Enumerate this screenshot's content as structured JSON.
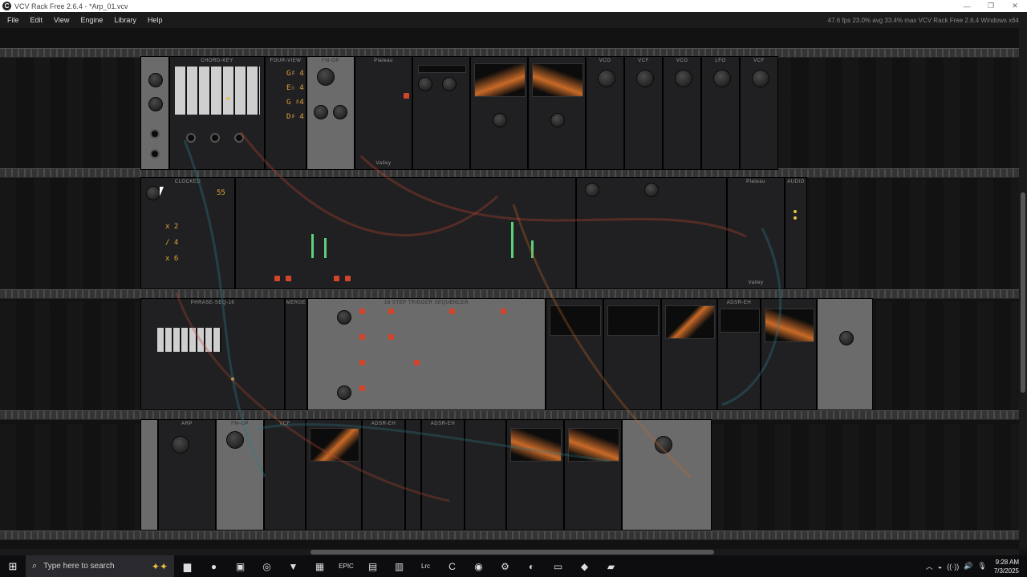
{
  "window": {
    "app_icon": "vcv-rack-icon",
    "title": "VCV Rack Free 2.6.4 - *Arp_01.vcv",
    "minimize_glyph": "—",
    "maximize_glyph": "❐",
    "close_glyph": "✕"
  },
  "menubar": {
    "items": [
      "File",
      "Edit",
      "View",
      "Engine",
      "Library",
      "Help"
    ],
    "status": "47.6 fps  23.0% avg  33.4% max     VCV Rack Free 2.6.4 Windows x64"
  },
  "modules": {
    "chord_key": "CHORD-KEY",
    "four_view": "FOUR-VIEW",
    "fm_op_1": "FM-OP",
    "plateau_1": "Plateau",
    "valley_1": "Valley",
    "vco_1": "VCO",
    "vcf_1": "VCF",
    "vco_2": "VCO",
    "lfo": "LFO",
    "vcf_2": "VCF",
    "clocked": "CLOCKED",
    "clocked_bpm": "55",
    "ratio_1": "x 2",
    "ratio_2": "/ 4",
    "ratio_3": "x 6",
    "plateau_2": "Plateau",
    "valley_2": "Valley",
    "audio": "AUDIO",
    "phrase_seq": "PHRASE-SEQ-16",
    "merge": "MERGE",
    "trigger_seq": "16 STEP TRIGGER SEQUENCER",
    "adsr": "ADSR-EH",
    "arp": "ARP",
    "fm_op_2": "FM-OP",
    "vcf_3": "VCF",
    "adsr_2": "ADSR-EH",
    "adsr_3": "ADSR-EH",
    "chord_names": [
      "G♯ 4",
      "E♭ 4",
      "G ♯4",
      "D♯ 4"
    ]
  },
  "taskbar": {
    "start_glyph": "⊞",
    "search_icon": "search-icon",
    "search_placeholder": "Type here to search",
    "search_deco": "✦✦",
    "apps": [
      {
        "name": "file-explorer-icon",
        "glyph": "▆"
      },
      {
        "name": "spotify-icon",
        "glyph": "●"
      },
      {
        "name": "recorder-icon",
        "glyph": "▣"
      },
      {
        "name": "vcv-rack-taskbar-icon",
        "glyph": "◎"
      },
      {
        "name": "brave-browser-icon",
        "glyph": "▼"
      },
      {
        "name": "app-grid-icon",
        "glyph": "▦"
      },
      {
        "name": "epic-games-icon",
        "glyph": "EPIC"
      },
      {
        "name": "image-app-icon",
        "glyph": "▤"
      },
      {
        "name": "chart-app-icon",
        "glyph": "▥"
      },
      {
        "name": "lrc-app-icon",
        "glyph": "Lrc"
      },
      {
        "name": "c-app-icon",
        "glyph": "C"
      },
      {
        "name": "edge-browser-icon",
        "glyph": "◉"
      },
      {
        "name": "steam-icon",
        "glyph": "⚙"
      },
      {
        "name": "discord-icon",
        "glyph": "◐"
      },
      {
        "name": "window-app-icon",
        "glyph": "▭"
      },
      {
        "name": "game-app-icon",
        "glyph": "◆"
      },
      {
        "name": "notes-app-icon",
        "glyph": "▰"
      }
    ],
    "tray_glyphs": [
      "︿",
      "◒",
      "((·))",
      "🔊",
      "🎙"
    ],
    "time": "9:28 AM",
    "date": "7/3/2025"
  },
  "colors": {
    "accent_led": "#d2452b",
    "amber": "#e0a33a",
    "meter_green": "#5fd07a"
  }
}
